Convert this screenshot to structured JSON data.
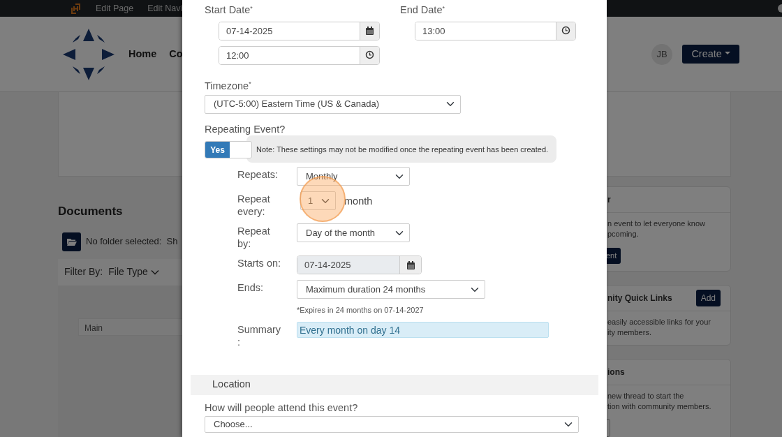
{
  "topbar": {
    "items": [
      {
        "label": "Edit Page"
      },
      {
        "label": "Edit Navi"
      }
    ]
  },
  "header": {
    "nav": [
      {
        "label": "Home"
      },
      {
        "label": "Co"
      }
    ],
    "avatar": "JB",
    "create_button": "Create"
  },
  "documents": {
    "title": "Documents",
    "folder_text": "No folder selected:  Sh",
    "filter_label": "Filter By:",
    "filter_value": "File Type",
    "folder_field": "Main"
  },
  "sidebar_cards": [
    {
      "title": "r",
      "lines": [
        "n event to let everyone know",
        "pcoming."
      ],
      "button": "ent"
    },
    {
      "title": "nity Quick Links",
      "header_button": "Add",
      "lines": [
        "easily accessible links for your",
        "ity members."
      ]
    },
    {
      "title": "ions",
      "lines": [
        "new thread to start the",
        "tion with community members."
      ],
      "outline_button": true
    }
  ],
  "modal": {
    "start_date": {
      "label": "Start Date$^{*}$",
      "date": "07-14-2025",
      "time": "12:00"
    },
    "end_date": {
      "label": "End Date$^{*}$",
      "time": "13:00"
    },
    "timezone": {
      "label": "Timezone$^{*}$",
      "value": "(UTC-5:00) Eastern Time (US & Canada)"
    },
    "repeating": {
      "label": "Repeating Event?",
      "on": true,
      "toggle_label": "Yes",
      "note": "Note: These settings may not be modified once the repeating event has been created."
    },
    "repeat_rows": [
      {
        "kind": "select",
        "label": "Repeats:",
        "value": "Monthly",
        "highlighted": false
      },
      {
        "kind": "small-select",
        "label": "Repeat every:",
        "value": "1",
        "suffix": "month",
        "highlighted": true
      },
      {
        "kind": "select",
        "label": "Repeat by:",
        "value": "Day of the month",
        "highlighted": false
      },
      {
        "kind": "date",
        "label": "Starts on:",
        "value": "07-14-2025",
        "disabled": true,
        "highlighted": false
      },
      {
        "kind": "wide-select",
        "label": "Ends:",
        "value": "Maximum duration 24 months",
        "hint": "*Expires in 24 months on 07-14-2027",
        "highlighted": false
      },
      {
        "kind": "summary",
        "label": "Summary :",
        "value": "Every month on day 14",
        "highlighted": false
      }
    ],
    "location": {
      "title": "Location",
      "question": "How will people attend this event?",
      "value": "Choose..."
    }
  }
}
